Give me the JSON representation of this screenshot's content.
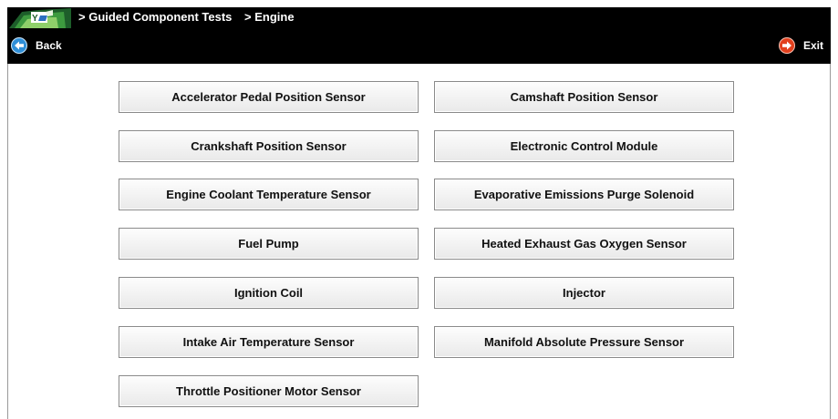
{
  "header": {
    "breadcrumbs": [
      "> Guided Component Tests",
      "> Engine"
    ],
    "back_label": "Back",
    "exit_label": "Exit"
  },
  "tests": [
    "Accelerator Pedal Position Sensor",
    "Camshaft Position Sensor",
    "Crankshaft Position Sensor",
    "Electronic Control Module",
    "Engine Coolant Temperature Sensor",
    "Evaporative Emissions Purge Solenoid",
    "Fuel Pump",
    "Heated Exhaust Gas Oxygen Sensor",
    "Ignition Coil",
    "Injector",
    "Intake Air Temperature Sensor",
    "Manifold Absolute Pressure Sensor",
    "Throttle Positioner Motor Sensor"
  ],
  "colors": {
    "topbar": "#000000",
    "back_icon": "#2f8fd8",
    "exit_icon": "#e2401d"
  },
  "icons": {
    "logo": "vehicle-logo-icon",
    "back": "left-arrow-circle-icon",
    "exit": "right-arrow-circle-icon"
  }
}
